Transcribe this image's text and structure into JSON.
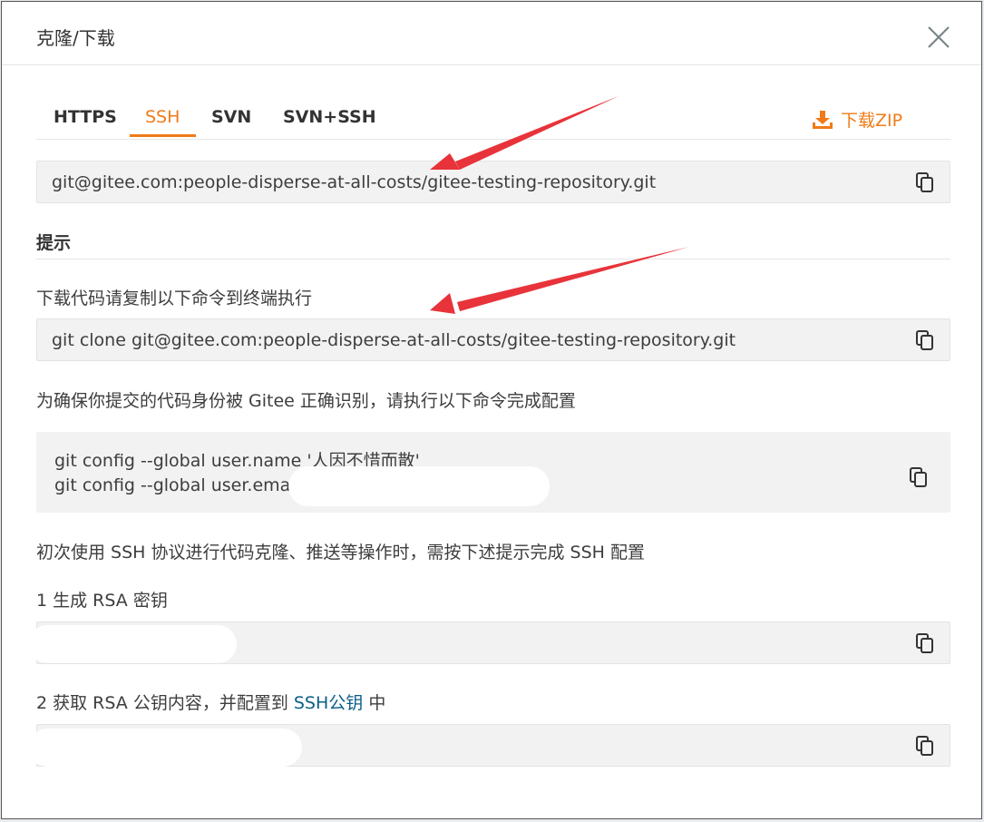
{
  "dialog": {
    "title": "克隆/下载"
  },
  "tabs": [
    {
      "label": "HTTPS"
    },
    {
      "label": "SSH"
    },
    {
      "label": "SVN"
    },
    {
      "label": "SVN+SSH"
    }
  ],
  "active_tab": "SSH",
  "download_zip": {
    "label": "下载ZIP"
  },
  "repo_url": "git@gitee.com:people-disperse-at-all-costs/gitee-testing-repository.git",
  "hint": {
    "title": "提示",
    "clone_instruction": "下载代码请复制以下命令到终端执行",
    "clone_command": "git clone git@gitee.com:people-disperse-at-all-costs/gitee-testing-repository.git",
    "identity_instruction": "为确保你提交的代码身份被 Gitee 正确识别，请执行以下命令完成配置",
    "config_name_cmd": "git config --global user.name '人因不惜而散'",
    "config_email_cmd": "git config --global user.ema",
    "ssh_first_time": "初次使用 SSH 协议进行代码克隆、推送等操作时，需按下述提示完成 SSH 配置",
    "step1": "1 生成 RSA 密钥",
    "step2_prefix": "2 获取 RSA 公钥内容，并配置到 ",
    "step2_link": "SSH公钥",
    "step2_suffix": " 中"
  },
  "colors": {
    "accent": "#f07b18",
    "link": "#0d5d8a",
    "arrow": "#e8333a"
  },
  "icons": [
    "close-icon",
    "download-icon",
    "copy-icon"
  ]
}
